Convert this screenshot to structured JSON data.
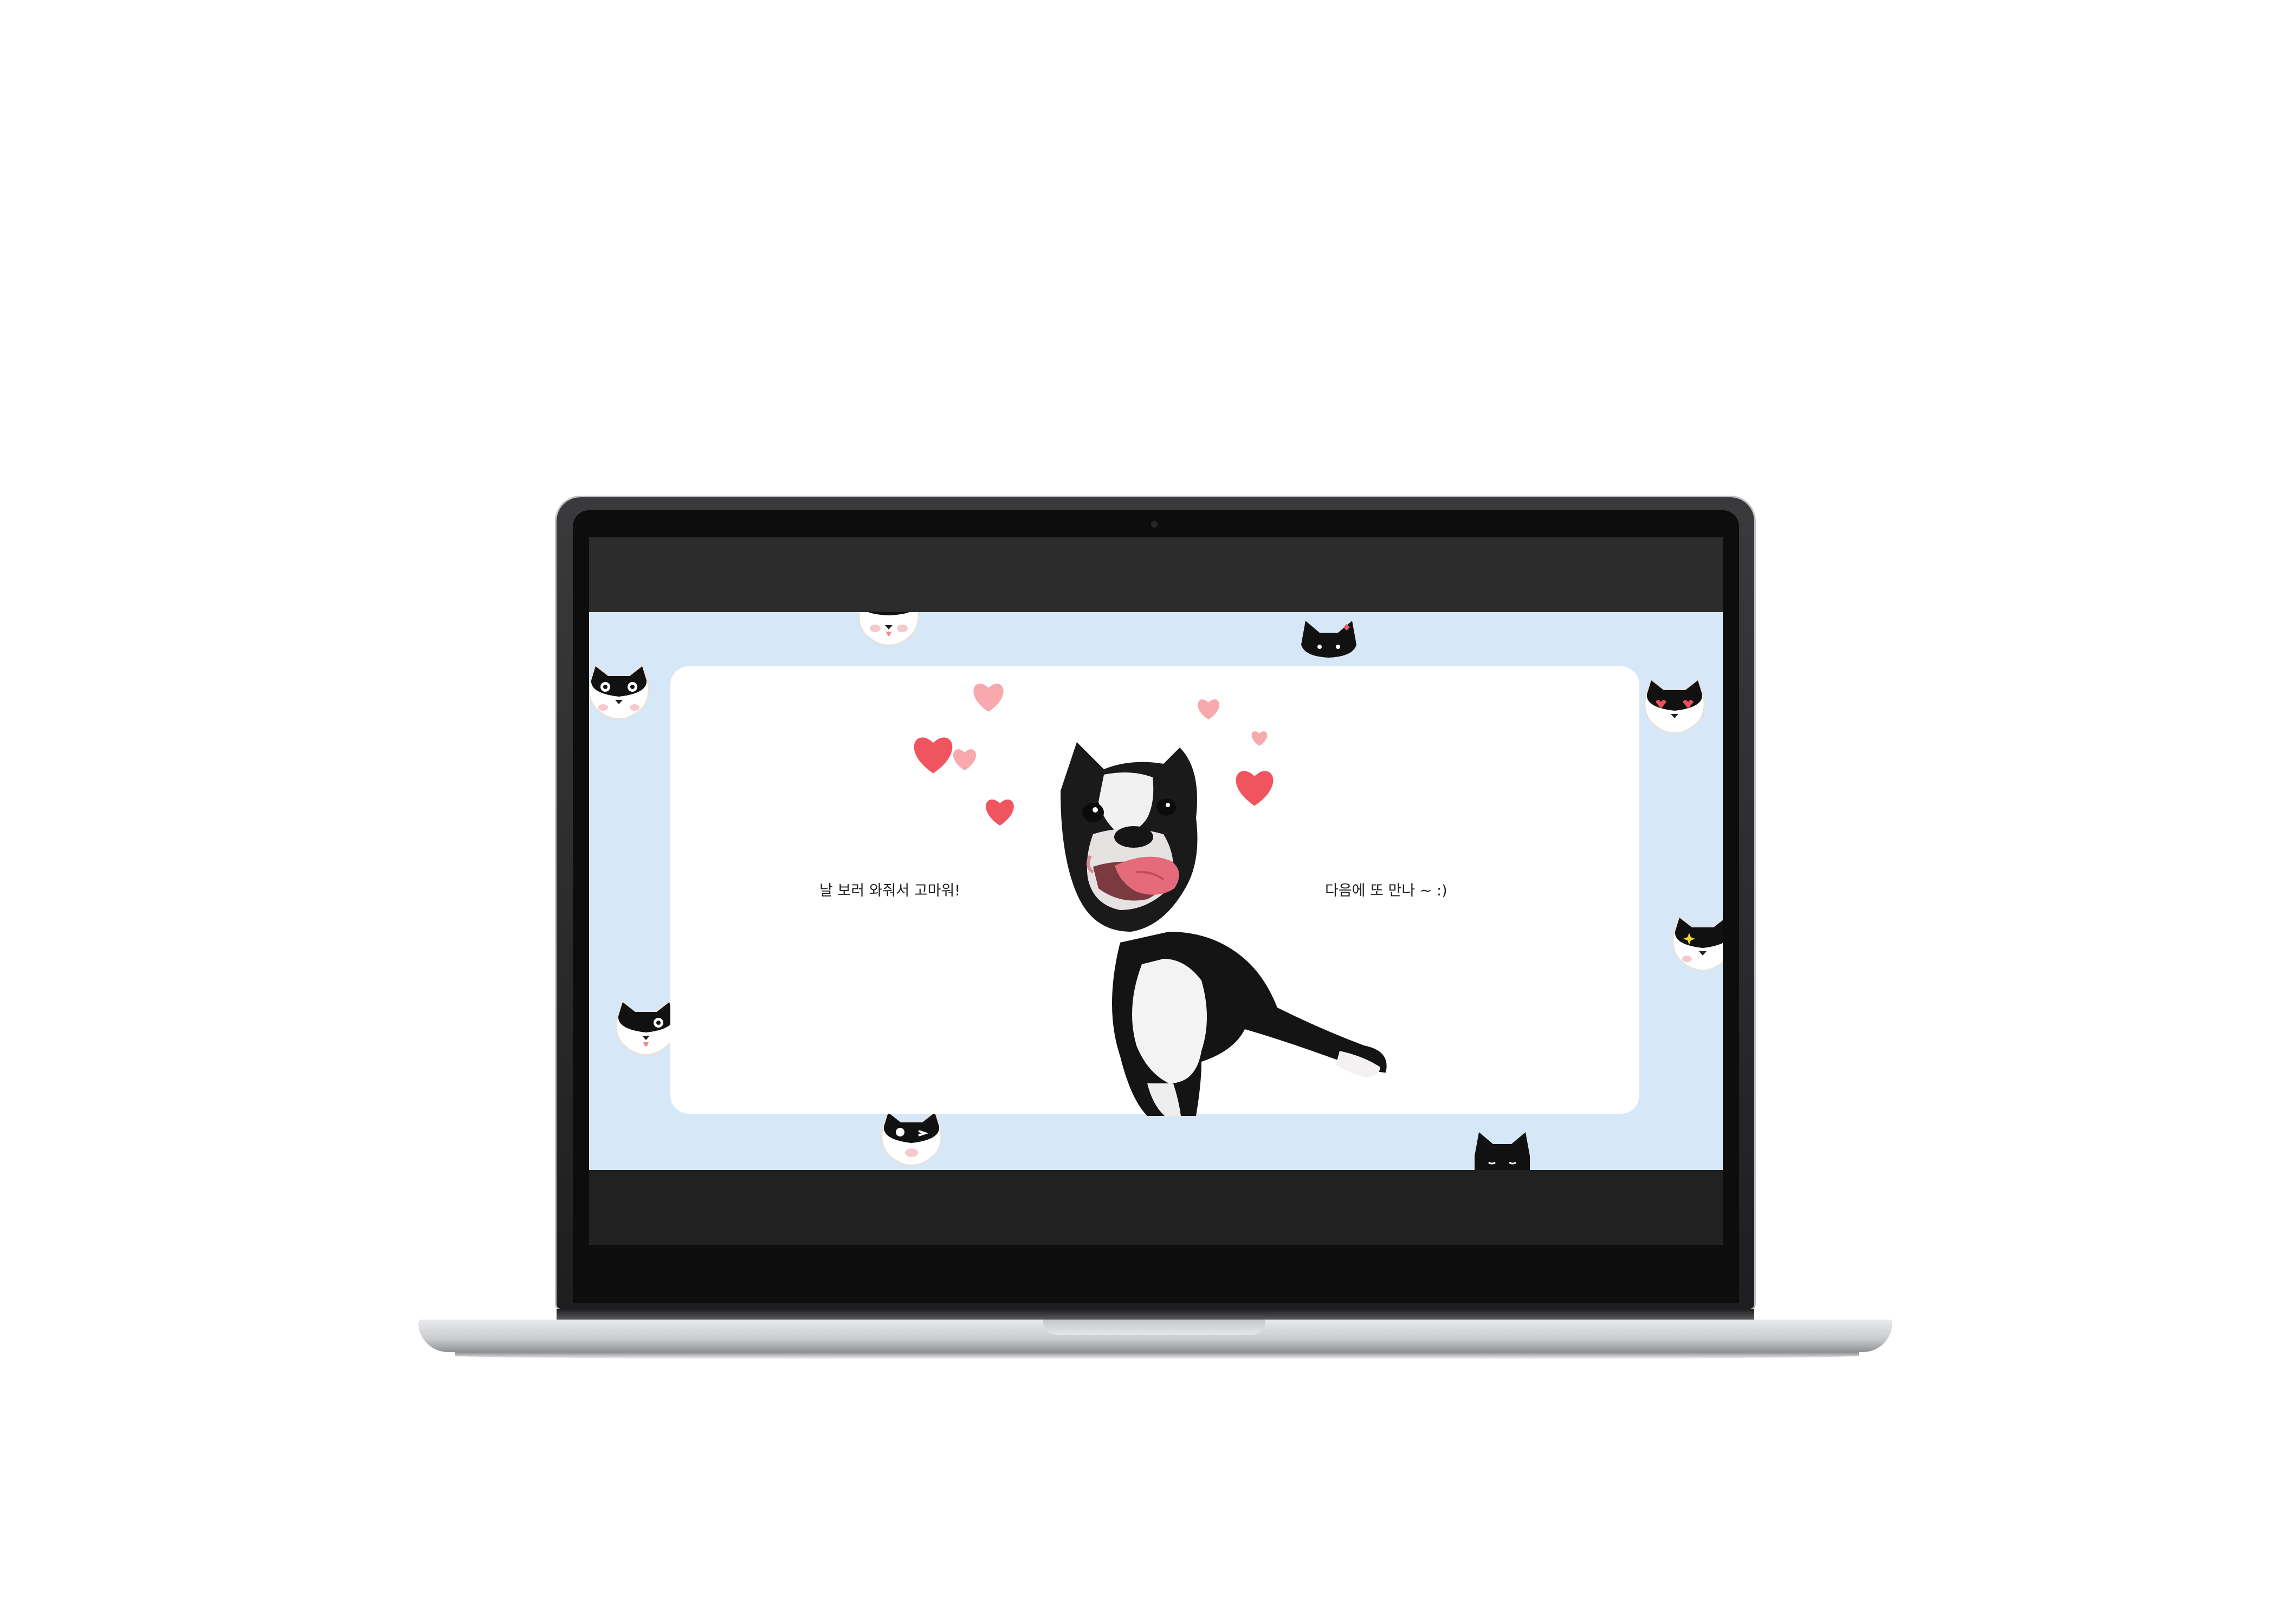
{
  "screen": {
    "message_left": "날 보러 와줘서 고마워!",
    "message_right": "다음에 또 만나 ~ :)"
  },
  "colors": {
    "page_background": "#d6e8f8",
    "card": "#ffffff",
    "heart": "#f0555f",
    "heart_light": "#f7a9ae",
    "bar": "#2c2c2c"
  },
  "icons": {
    "cat": "cat-face-icon",
    "heart": "heart-icon",
    "dog": "dog-photo"
  }
}
